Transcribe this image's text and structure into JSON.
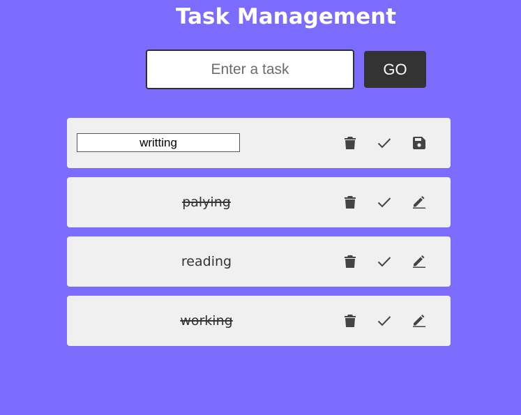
{
  "header": {
    "title": "Task Management"
  },
  "new_task": {
    "placeholder": "Enter a task",
    "value": "",
    "submit_label": "GO"
  },
  "tasks": [
    {
      "text": "writting",
      "completed": false,
      "editing": true,
      "actions": [
        "trash-icon",
        "check-icon",
        "save-icon"
      ]
    },
    {
      "text": "palying",
      "completed": true,
      "editing": false,
      "actions": [
        "trash-icon",
        "check-icon",
        "pencil-icon"
      ]
    },
    {
      "text": "reading",
      "completed": false,
      "editing": false,
      "actions": [
        "trash-icon",
        "check-icon",
        "pencil-icon"
      ]
    },
    {
      "text": "working",
      "completed": true,
      "editing": false,
      "actions": [
        "trash-icon",
        "check-icon",
        "pencil-icon"
      ]
    }
  ],
  "colors": {
    "background": "#7b6cfd",
    "card": "#f0f0f0",
    "button": "#333333",
    "icon": "#444444"
  }
}
